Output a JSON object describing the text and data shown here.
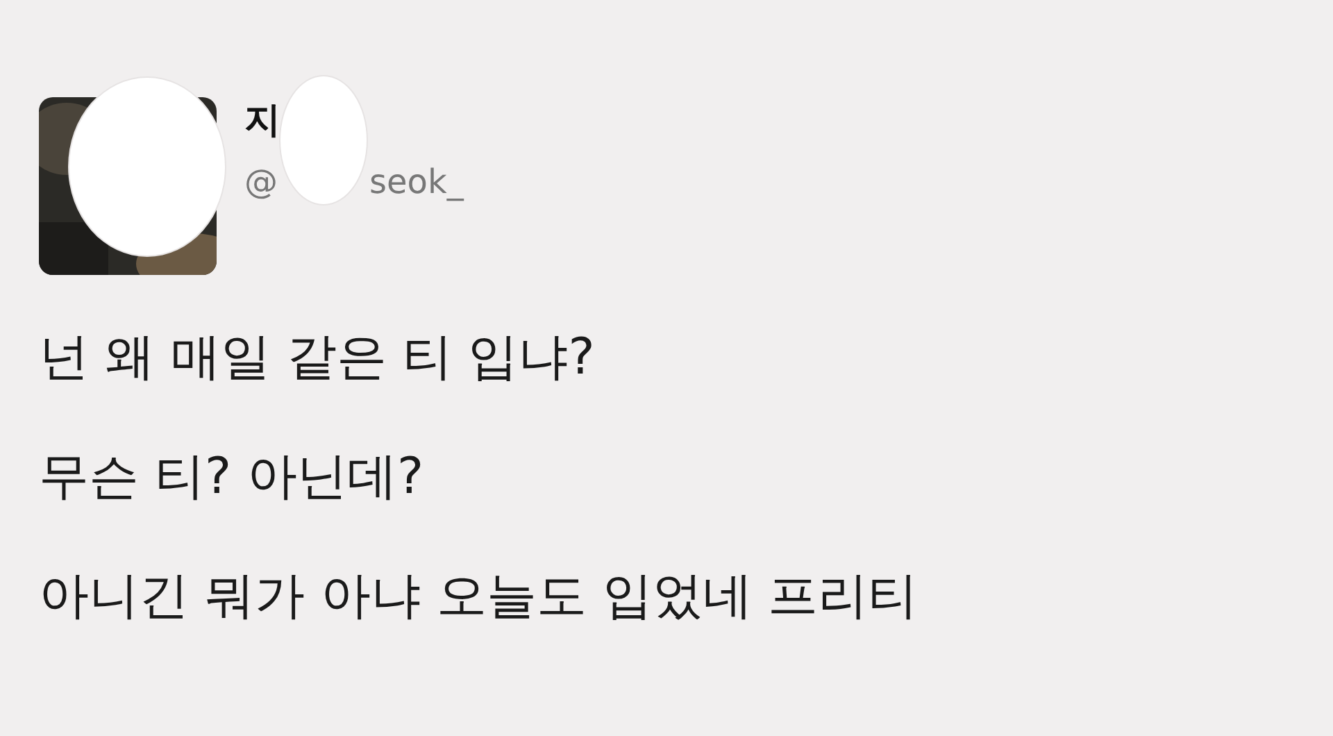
{
  "author": {
    "name": "지",
    "handle_start": "@",
    "handle_end": "seok_"
  },
  "lines": [
    "넌 왜 매일 같은 티 입냐?",
    "무슨 티? 아닌데?",
    "아니긴 뭐가 아냐 오늘도 입었네 프리티"
  ]
}
